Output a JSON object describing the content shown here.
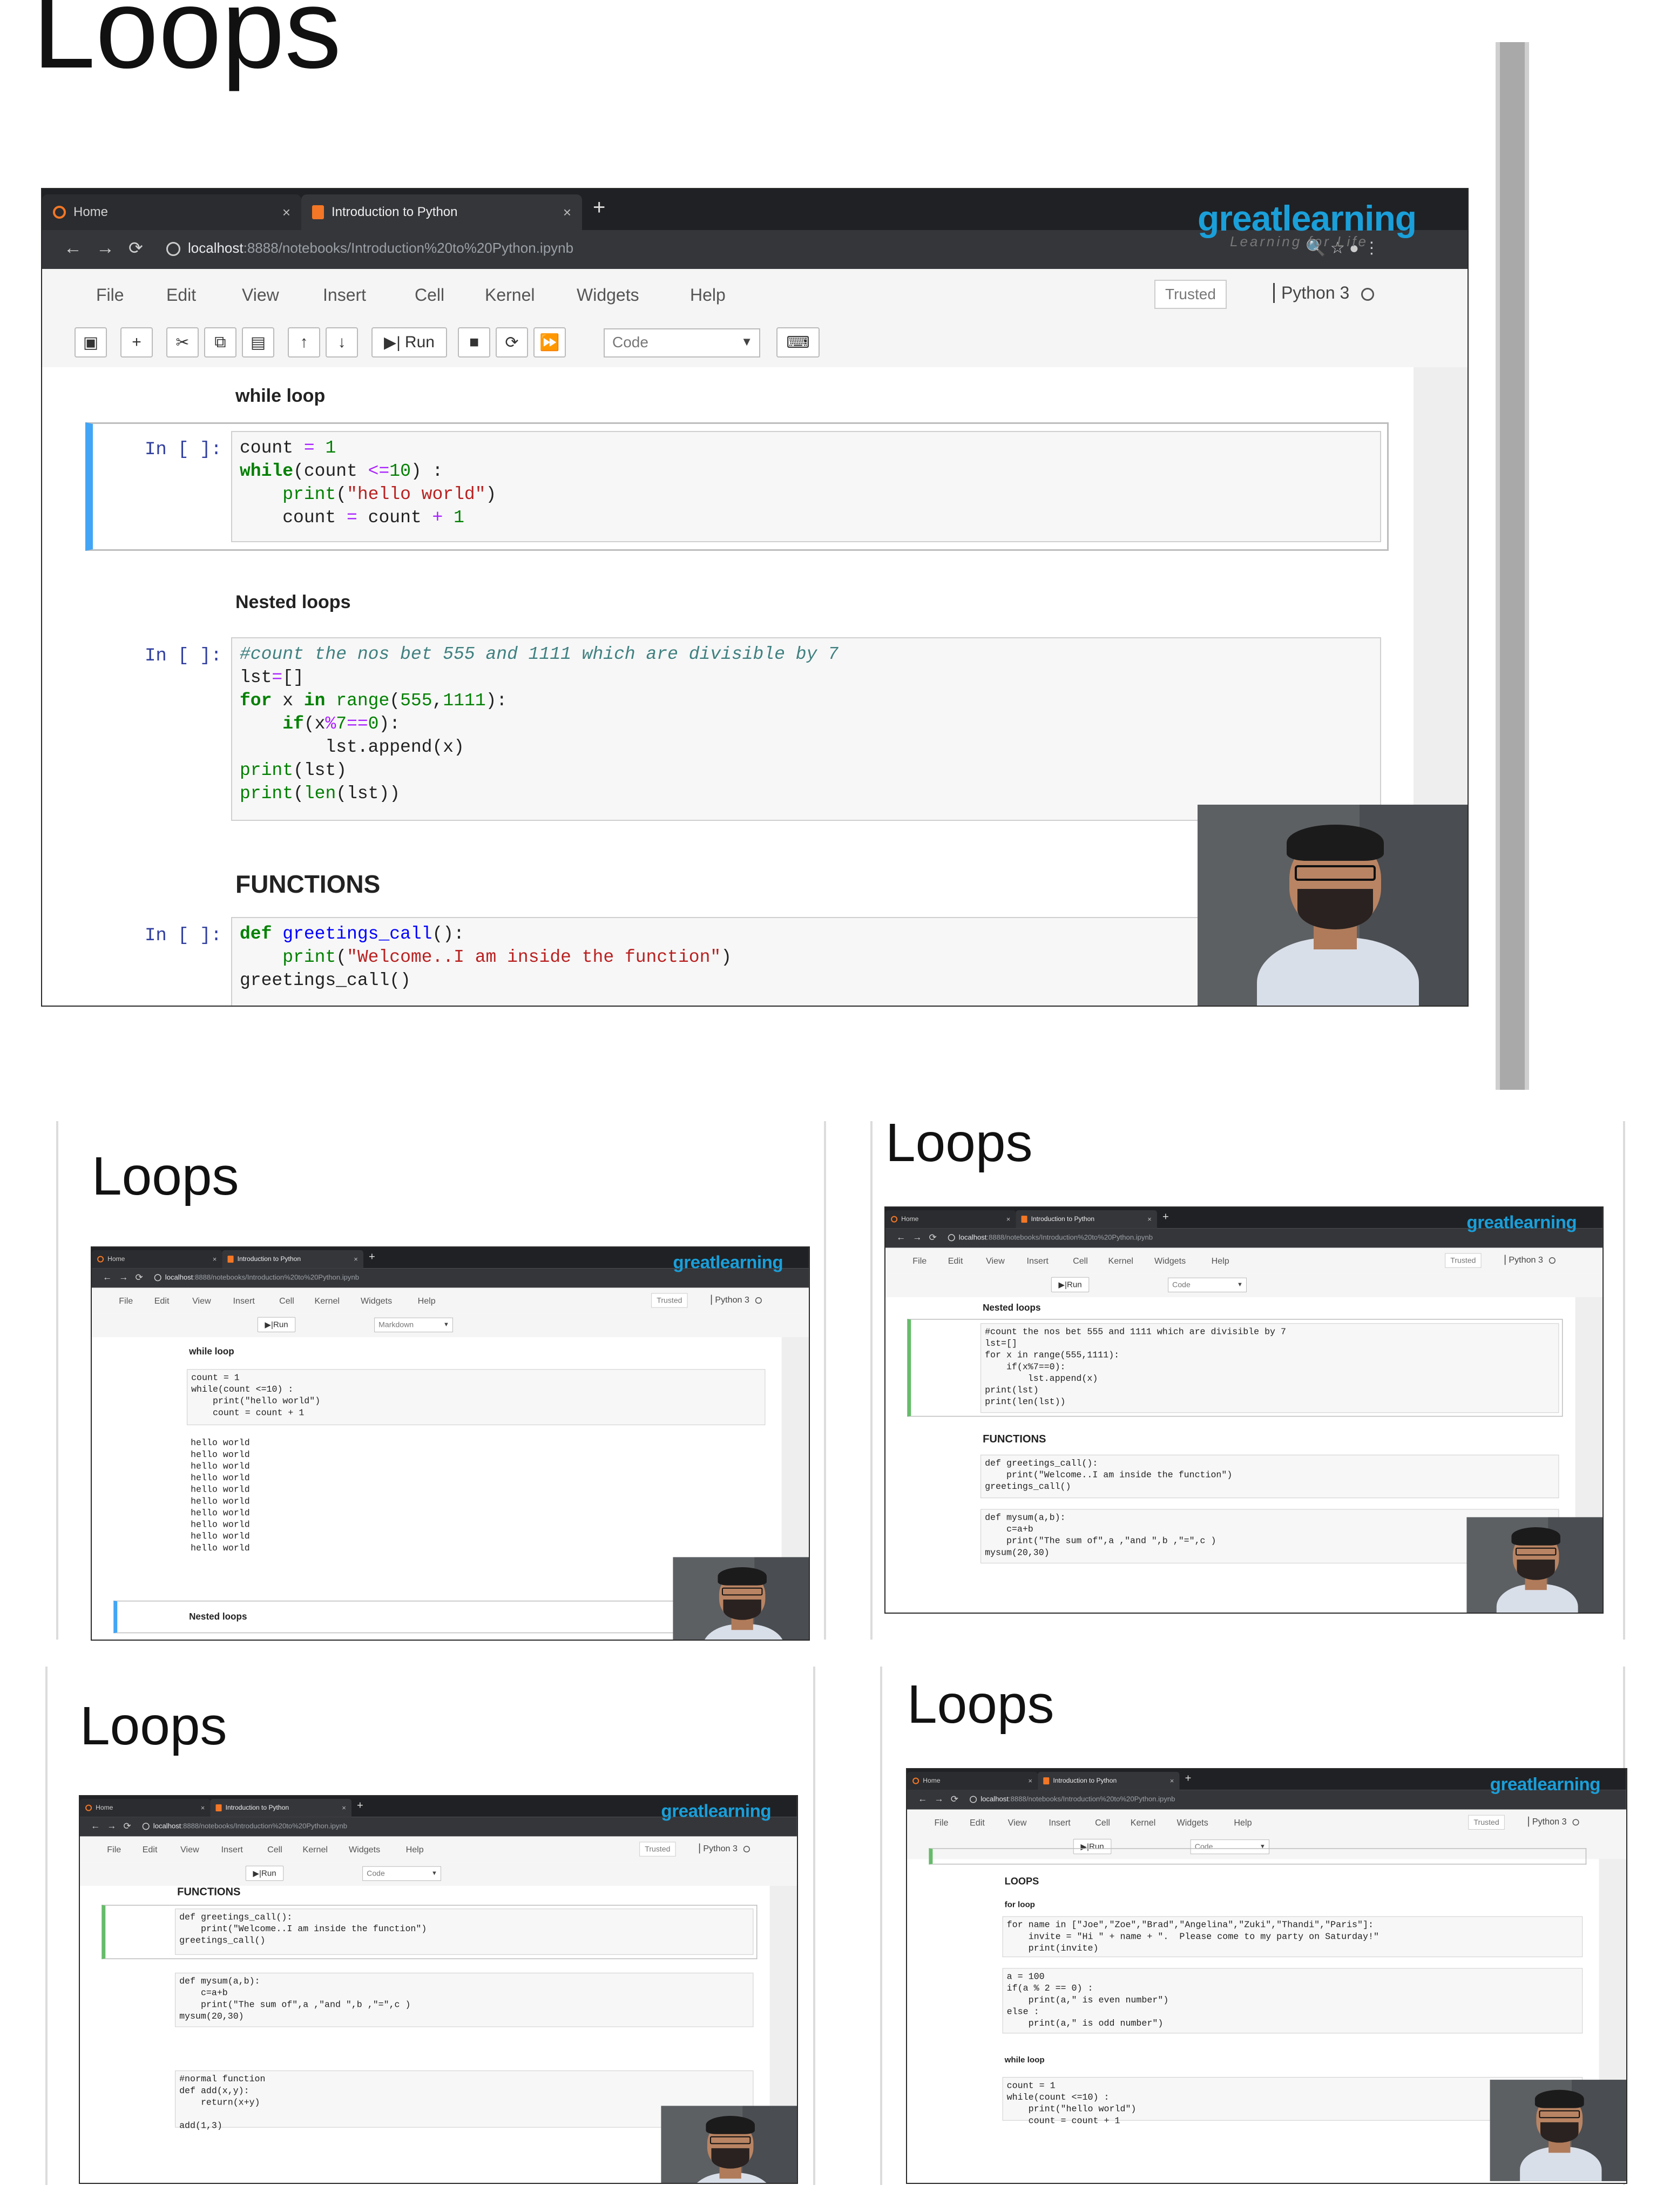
{
  "slides": [
    {
      "title": "Loops",
      "note_cell_type": "Code"
    },
    {
      "title": "Loops",
      "note_cell_type": "Markdown"
    },
    {
      "title": "Loops",
      "note_cell_type": "Code"
    },
    {
      "title": "Loops",
      "note_cell_type": "Code"
    },
    {
      "title": "Loops",
      "note_cell_type": "Code"
    }
  ],
  "browser": {
    "tab_home": "Home",
    "tab_notebook": "Introduction to Python",
    "tab_close": "×",
    "new_tab": "+",
    "url_host": "localhost",
    "url_path": ":8888/notebooks/Introduction%20to%20Python.ipynb",
    "brand": "greatlearning",
    "brand_sub": "Learning for Life"
  },
  "menu": {
    "items": [
      "File",
      "Edit",
      "View",
      "Insert",
      "Cell",
      "Kernel",
      "Widgets",
      "Help"
    ],
    "trusted": "Trusted",
    "kernel": "Python 3"
  },
  "toolbar": {
    "run": "Run",
    "cell_type": "Code"
  },
  "notebook": {
    "prompt": "In [ ]:",
    "while_heading": "while loop",
    "nested_heading": "Nested loops",
    "functions_heading": "FUNCTIONS"
  },
  "accent_colors": {
    "brand_blue": "#1a9fd9",
    "selected_cell": "#42a5f5",
    "keyword": "#008000",
    "string": "#ba2121"
  }
}
